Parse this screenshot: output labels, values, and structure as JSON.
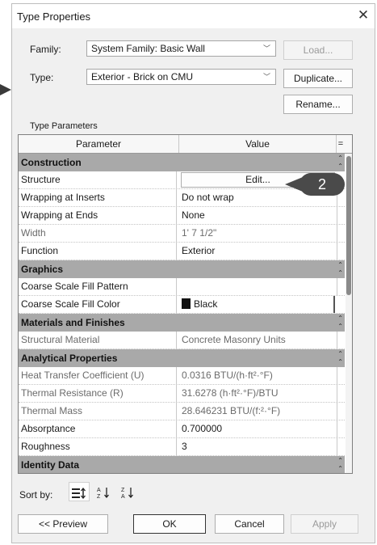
{
  "dialog": {
    "title": "Type Properties",
    "close_label": "✕"
  },
  "family": {
    "label": "Family:",
    "value": "System Family: Basic Wall",
    "load_label": "Load..."
  },
  "type": {
    "label": "Type:",
    "value": "Exterior - Brick on CMU",
    "duplicate_label": "Duplicate...",
    "rename_label": "Rename..."
  },
  "type_parameters_label": "Type Parameters",
  "grid": {
    "col_parameter": "Parameter",
    "col_value": "Value",
    "col_extra": "=",
    "groups": {
      "construction": "Construction",
      "graphics": "Graphics",
      "materials": "Materials and Finishes",
      "analytical": "Analytical Properties",
      "identity": "Identity Data"
    },
    "rows": {
      "structure": {
        "name": "Structure",
        "value": "Edit..."
      },
      "wrap_inserts": {
        "name": "Wrapping at Inserts",
        "value": "Do not wrap"
      },
      "wrap_ends": {
        "name": "Wrapping at Ends",
        "value": "None"
      },
      "width": {
        "name": "Width",
        "value": "1'  7 1/2\""
      },
      "function": {
        "name": "Function",
        "value": "Exterior"
      },
      "coarse_pattern": {
        "name": "Coarse Scale Fill Pattern",
        "value": ""
      },
      "coarse_color": {
        "name": "Coarse Scale Fill Color",
        "value": "Black"
      },
      "structural_material": {
        "name": "Structural Material",
        "value": "Concrete Masonry Units"
      },
      "heat_transfer": {
        "name": "Heat Transfer Coefficient (U)",
        "value": "0.0316 BTU/(h·ft²·°F)"
      },
      "thermal_resistance": {
        "name": "Thermal Resistance (R)",
        "value": "31.6278 (h·ft²·°F)/BTU"
      },
      "thermal_mass": {
        "name": "Thermal Mass",
        "value": "28.646231 BTU/(f:²·°F)"
      },
      "absorptance": {
        "name": "Absorptance",
        "value": "0.700000"
      },
      "roughness": {
        "name": "Roughness",
        "value": "3"
      }
    }
  },
  "callout_number": "2",
  "sort": {
    "label": "Sort by:"
  },
  "footer": {
    "preview_label": "<< Preview",
    "ok_label": "OK",
    "cancel_label": "Cancel",
    "apply_label": "Apply"
  }
}
